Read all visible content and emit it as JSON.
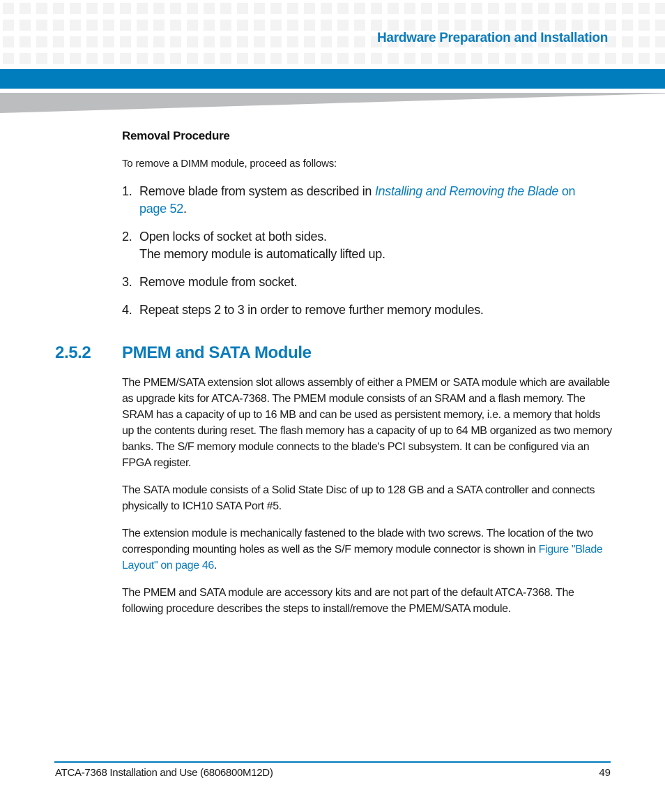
{
  "header": {
    "title": "Hardware Preparation and Installation",
    "accent_color": "#017cbd"
  },
  "removal": {
    "heading": "Removal Procedure",
    "intro": "To remove a DIMM module, proceed as follows:",
    "steps": [
      {
        "num": "1.",
        "text_before": "Remove blade from system as described in ",
        "link_italic": "Installing and Removing the Blade",
        "link_rest": " on page 52",
        "text_after": "."
      },
      {
        "num": "2.",
        "text": "Open locks of socket at both sides.",
        "subtext": "The memory module is automatically lifted up."
      },
      {
        "num": "3.",
        "text": "Remove module from socket."
      },
      {
        "num": "4.",
        "text": "Repeat steps 2 to 3 in order to remove further memory modules."
      }
    ]
  },
  "section": {
    "number": "2.5.2",
    "title": "PMEM and SATA Module",
    "paragraphs": [
      "The PMEM/SATA extension slot allows assembly of either a PMEM or SATA module which are available as upgrade kits for ATCA-7368. The PMEM module consists of an SRAM and a flash memory. The SRAM has a capacity of up to 16 MB and can be used as persistent memory, i.e. a memory that holds up the contents during reset. The flash memory has a capacity of up to 64 MB organized as two memory banks. The S/F memory module connects to the blade's PCI subsystem. It can be configured via an FPGA register.",
      "The SATA module consists of a Solid State Disc of up to 128 GB and a SATA controller and connects physically to ICH10 SATA Port #5."
    ],
    "para3": {
      "text_before": "The extension module is mechanically fastened to the blade with two screws. The location of the two corresponding mounting holes as well as the S/F memory module connector is shown in ",
      "link": "Figure \"Blade Layout\" on page 46",
      "text_after": "."
    },
    "para4": "The PMEM and SATA module are accessory kits and are not part of the default ATCA-7368.  The following procedure describes the steps to install/remove the PMEM/SATA module."
  },
  "footer": {
    "doc_title": "ATCA-7368 Installation and Use (6806800M12D)",
    "page_number": "49"
  }
}
